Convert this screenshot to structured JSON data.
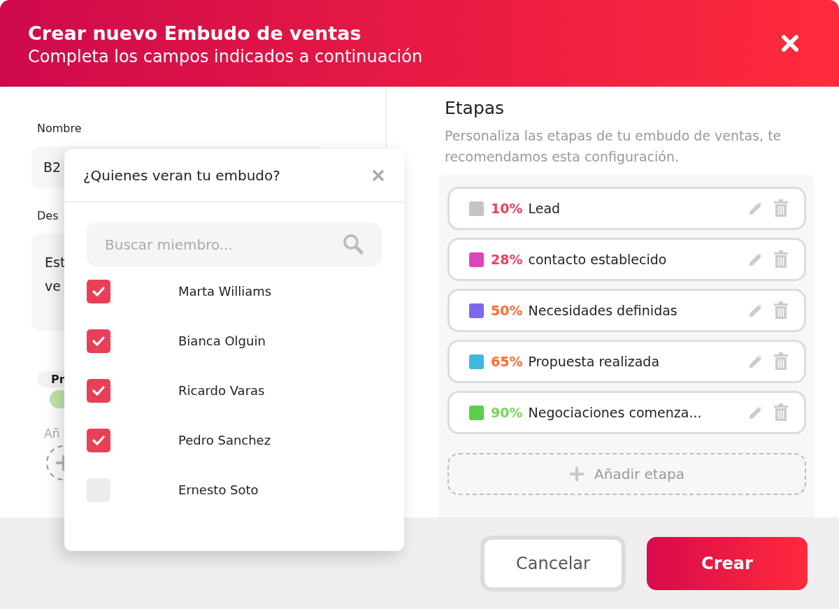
{
  "header": {
    "title": "Crear nuevo Embudo de ventas",
    "subtitle": "Completa los campos indicados a continuación"
  },
  "left_form": {
    "name_label": "Nombre",
    "name_value": "B2",
    "description_label": "Des",
    "description_lines": [
      "Est",
      "ve"
    ],
    "toggle_label": "Pr",
    "toggle_on": true,
    "add_label": "Añ"
  },
  "members_popup": {
    "title": "¿Quienes veran tu embudo?",
    "search": {
      "placeholder": "Buscar miembro..."
    },
    "members": [
      {
        "name": "Marta Williams",
        "checked": true
      },
      {
        "name": "Bianca Olguin",
        "checked": true
      },
      {
        "name": "Ricardo Varas",
        "checked": true
      },
      {
        "name": "Pedro Sanchez",
        "checked": true
      },
      {
        "name": "Ernesto Soto",
        "checked": false
      }
    ]
  },
  "stages": {
    "title": "Etapas",
    "description": "Personaliza las etapas de tu embudo de ventas, te recomendamos esta configuración.",
    "items": [
      {
        "kind": "low",
        "percent": "10%",
        "name": "Lead",
        "color": "#c4c4c4"
      },
      {
        "kind": "low",
        "percent": "28%",
        "name": "contacto establecido",
        "color": "#dd44bb"
      },
      {
        "kind": "mid",
        "percent": "50%",
        "name": "Necesidades definidas",
        "color": "#7b68ee"
      },
      {
        "kind": "mid",
        "percent": "65%",
        "name": "Propuesta realizada",
        "color": "#3fb8e0"
      },
      {
        "kind": "high",
        "percent": "90%",
        "name": "Negociaciones comenza...",
        "color": "#5ccf4a"
      }
    ],
    "add_button": "Añadir etapa"
  },
  "buttons": {
    "cancel": "Cancelar",
    "create": "Crear"
  }
}
